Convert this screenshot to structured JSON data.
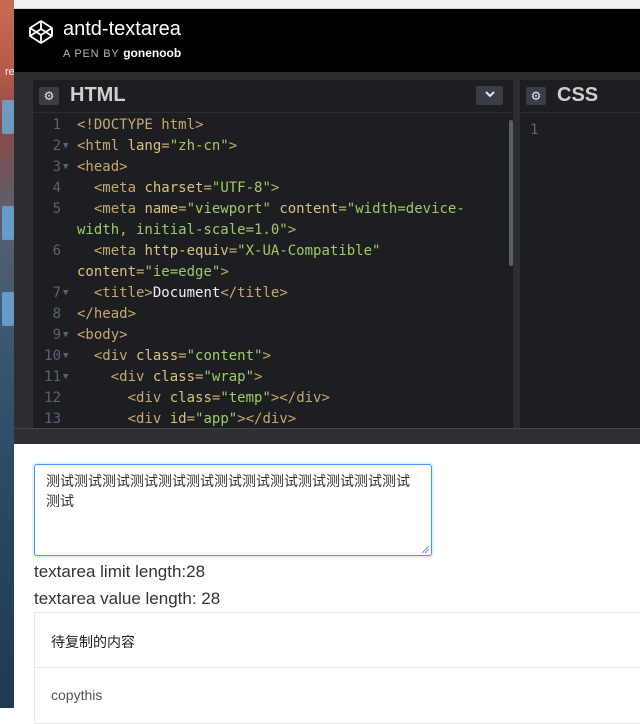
{
  "header": {
    "title": "antd-textarea",
    "by_prefix": "A PEN BY",
    "author": "gonenoob"
  },
  "desktop": {
    "label": "re"
  },
  "html_panel": {
    "name": "HTML",
    "lines": [
      {
        "n": "1",
        "fold": false,
        "segs": [
          {
            "c": "t",
            "v": "<!DOCTYPE html>"
          }
        ]
      },
      {
        "n": "2",
        "fold": true,
        "segs": [
          {
            "c": "t",
            "v": "<html "
          },
          {
            "c": "a",
            "v": "lang"
          },
          {
            "c": "t",
            "v": "="
          },
          {
            "c": "s",
            "v": "\"zh-cn\""
          },
          {
            "c": "t",
            "v": ">"
          }
        ]
      },
      {
        "n": "3",
        "fold": true,
        "segs": [
          {
            "c": "t",
            "v": "<head>"
          }
        ]
      },
      {
        "n": "4",
        "fold": false,
        "segs": [
          {
            "c": "w",
            "v": "  "
          },
          {
            "c": "t",
            "v": "<meta "
          },
          {
            "c": "a",
            "v": "charset"
          },
          {
            "c": "t",
            "v": "="
          },
          {
            "c": "s",
            "v": "\"UTF-8\""
          },
          {
            "c": "t",
            "v": ">"
          }
        ]
      },
      {
        "n": "5",
        "fold": false,
        "segs": [
          {
            "c": "w",
            "v": "  "
          },
          {
            "c": "t",
            "v": "<meta "
          },
          {
            "c": "a",
            "v": "name"
          },
          {
            "c": "t",
            "v": "="
          },
          {
            "c": "s",
            "v": "\"viewport\""
          },
          {
            "c": "t",
            "v": " "
          },
          {
            "c": "a",
            "v": "content"
          },
          {
            "c": "t",
            "v": "="
          },
          {
            "c": "s",
            "v": "\"width=device-"
          }
        ]
      },
      {
        "n": "",
        "fold": false,
        "segs": [
          {
            "c": "s",
            "v": "width, initial-scale=1.0\""
          },
          {
            "c": "t",
            "v": ">"
          }
        ]
      },
      {
        "n": "6",
        "fold": false,
        "segs": [
          {
            "c": "w",
            "v": "  "
          },
          {
            "c": "t",
            "v": "<meta "
          },
          {
            "c": "a",
            "v": "http-equiv"
          },
          {
            "c": "t",
            "v": "="
          },
          {
            "c": "s",
            "v": "\"X-UA-Compatible\""
          }
        ]
      },
      {
        "n": "",
        "fold": false,
        "segs": [
          {
            "c": "a",
            "v": "content"
          },
          {
            "c": "t",
            "v": "="
          },
          {
            "c": "s",
            "v": "\"ie=edge\""
          },
          {
            "c": "t",
            "v": ">"
          }
        ]
      },
      {
        "n": "7",
        "fold": true,
        "segs": [
          {
            "c": "w",
            "v": "  "
          },
          {
            "c": "t",
            "v": "<title>"
          },
          {
            "c": "w",
            "v": "Document"
          },
          {
            "c": "t",
            "v": "</title>"
          }
        ]
      },
      {
        "n": "8",
        "fold": false,
        "segs": [
          {
            "c": "t",
            "v": "</head>"
          }
        ]
      },
      {
        "n": "9",
        "fold": true,
        "segs": [
          {
            "c": "t",
            "v": "<body>"
          }
        ]
      },
      {
        "n": "10",
        "fold": true,
        "segs": [
          {
            "c": "w",
            "v": "  "
          },
          {
            "c": "t",
            "v": "<div "
          },
          {
            "c": "a",
            "v": "class"
          },
          {
            "c": "t",
            "v": "="
          },
          {
            "c": "s",
            "v": "\"content\""
          },
          {
            "c": "t",
            "v": ">"
          }
        ]
      },
      {
        "n": "11",
        "fold": true,
        "segs": [
          {
            "c": "w",
            "v": "    "
          },
          {
            "c": "t",
            "v": "<div "
          },
          {
            "c": "a",
            "v": "class"
          },
          {
            "c": "t",
            "v": "="
          },
          {
            "c": "s",
            "v": "\"wrap\""
          },
          {
            "c": "t",
            "v": ">"
          }
        ]
      },
      {
        "n": "12",
        "fold": false,
        "segs": [
          {
            "c": "w",
            "v": "      "
          },
          {
            "c": "t",
            "v": "<div "
          },
          {
            "c": "a",
            "v": "class"
          },
          {
            "c": "t",
            "v": "="
          },
          {
            "c": "s",
            "v": "\"temp\""
          },
          {
            "c": "t",
            "v": "></div>"
          }
        ]
      },
      {
        "n": "13",
        "fold": false,
        "segs": [
          {
            "c": "w",
            "v": "      "
          },
          {
            "c": "t",
            "v": "<div "
          },
          {
            "c": "a",
            "v": "id"
          },
          {
            "c": "t",
            "v": "="
          },
          {
            "c": "s",
            "v": "\"app\""
          },
          {
            "c": "t",
            "v": "></div>"
          }
        ]
      }
    ]
  },
  "css_panel": {
    "name": "CSS",
    "line": "1"
  },
  "result": {
    "textarea_value": "测试测试测试测试测试测试测试测试测试测试测试测试测试测试",
    "limit_label": "textarea limit length:28",
    "value_label": "textarea value length: 28",
    "card_title": "待复制的内容",
    "card_body": "copythis"
  },
  "colors": {
    "header_bg": "#000000",
    "editor_bg": "#1d1e22",
    "focus_border": "#4096ff"
  }
}
